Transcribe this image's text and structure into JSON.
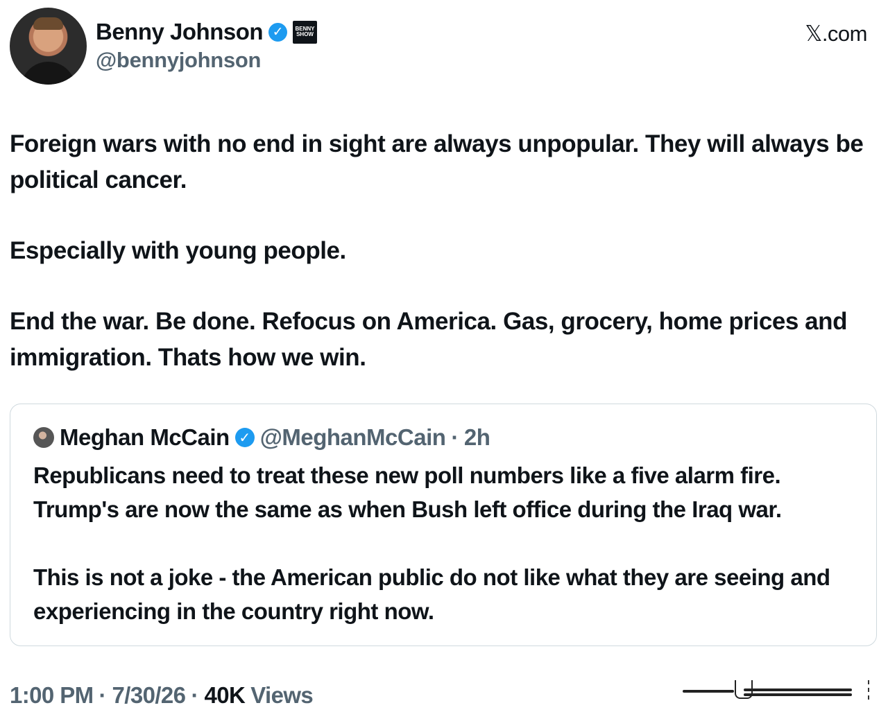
{
  "author": {
    "display_name": "Benny Johnson",
    "handle": "@bennyjohnson",
    "verified_icon": "verified-check-icon",
    "badge_text": "BENNY SHOW",
    "brand_color": "#1d9bf0"
  },
  "site": {
    "label": "𝕏.com"
  },
  "tweet": {
    "paragraphs": [
      "Foreign wars with no end in sight are always unpopular. They will always be political cancer.",
      "Especially with young people.",
      "End the war. Be done. Refocus on America. Gas, grocery, home prices and immigration. Thats how we win."
    ]
  },
  "quote": {
    "display_name": "Meghan McCain",
    "handle": "@MeghanMcCain",
    "dot": "·",
    "time": "2h",
    "paragraphs": [
      "Republicans need to treat these new poll numbers like a five alarm fire. Trump's are now the same as when Bush left office during the Iraq war.",
      "This is not a joke - the American public do not like what they are seeing and experiencing in the country right now."
    ]
  },
  "footer": {
    "time": "1:00 PM",
    "date": "7/30/26",
    "separator": "·",
    "views_count": "40K",
    "views_label": "Views"
  },
  "colors": {
    "text_primary": "#0f1419",
    "text_secondary": "#536471",
    "border": "#cfd9de",
    "verified": "#1d9bf0"
  }
}
